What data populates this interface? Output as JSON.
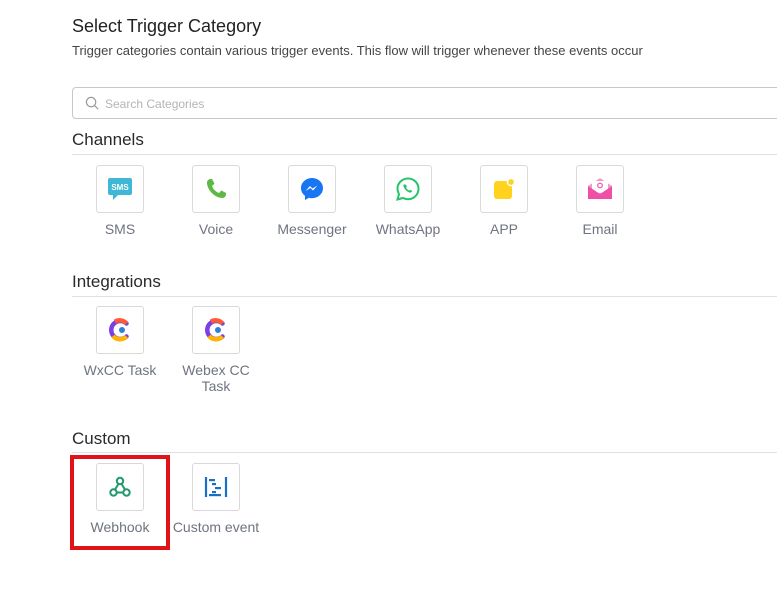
{
  "header": {
    "title": "Select Trigger Category",
    "subtitle": "Trigger categories contain various trigger events. This flow will trigger whenever these events occur"
  },
  "search": {
    "placeholder": "Search Categories"
  },
  "sections": {
    "channels": {
      "title": "Channels",
      "items": [
        {
          "label": "SMS",
          "icon": "sms-icon"
        },
        {
          "label": "Voice",
          "icon": "phone-icon"
        },
        {
          "label": "Messenger",
          "icon": "messenger-icon"
        },
        {
          "label": "WhatsApp",
          "icon": "whatsapp-icon"
        },
        {
          "label": "APP",
          "icon": "app-icon"
        },
        {
          "label": "Email",
          "icon": "email-icon"
        }
      ]
    },
    "integrations": {
      "title": "Integrations",
      "items": [
        {
          "label": "WxCC Task",
          "icon": "wxcc-icon"
        },
        {
          "label": "Webex CC Task",
          "icon": "webex-cc-icon"
        }
      ]
    },
    "custom": {
      "title": "Custom",
      "items": [
        {
          "label": "Webhook",
          "icon": "webhook-icon"
        },
        {
          "label": "Custom event",
          "icon": "custom-event-icon"
        }
      ]
    }
  },
  "colors": {
    "sms": "#3fb8d6",
    "voice": "#5db846",
    "messenger": "#1976f2",
    "whatsapp": "#25c466",
    "app": "#ffd21f",
    "email": "#f04fa8",
    "webhook": "#1f9a6a",
    "custom_event": "#1a6fc4",
    "highlight": "#e0131b"
  }
}
